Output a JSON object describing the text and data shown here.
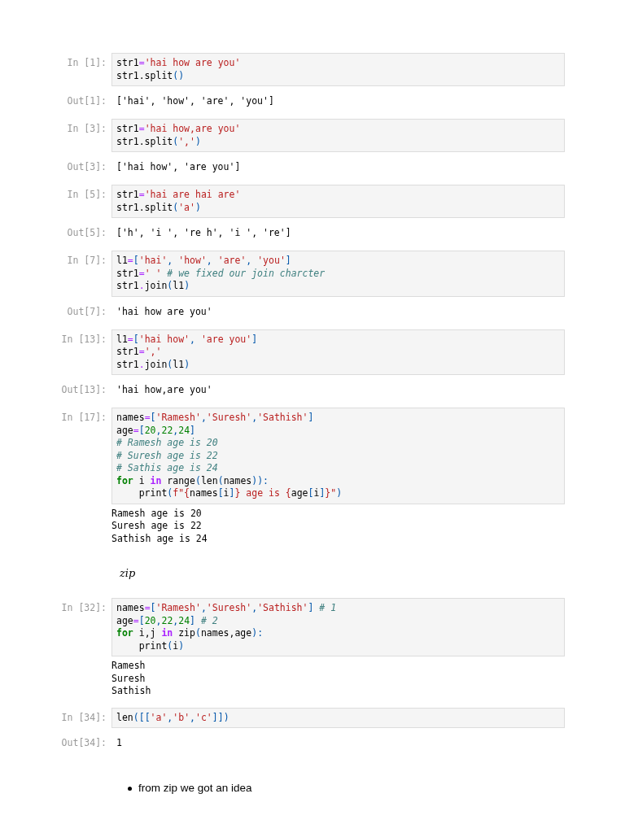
{
  "cells": [
    {
      "kind": "code",
      "prompt": "In [1]:",
      "lines": [
        [
          {
            "kind": "name",
            "text": "str1"
          },
          {
            "kind": "op",
            "text": "="
          },
          {
            "kind": "str",
            "text": "'hai how are you'"
          }
        ],
        [
          {
            "kind": "name",
            "text": "str1.split"
          },
          {
            "kind": "punct",
            "text": "()"
          }
        ]
      ],
      "output": {
        "kind": "result",
        "prompt": "Out[1]:",
        "lines": [
          "['hai', 'how', 'are', 'you']"
        ]
      }
    },
    {
      "kind": "code",
      "prompt": "In [3]:",
      "lines": [
        [
          {
            "kind": "name",
            "text": "str1"
          },
          {
            "kind": "op",
            "text": "="
          },
          {
            "kind": "str",
            "text": "'hai how,are you'"
          }
        ],
        [
          {
            "kind": "name",
            "text": "str1.split"
          },
          {
            "kind": "punct",
            "text": "("
          },
          {
            "kind": "str",
            "text": "','"
          },
          {
            "kind": "punct",
            "text": ")"
          }
        ]
      ],
      "output": {
        "kind": "result",
        "prompt": "Out[3]:",
        "lines": [
          "['hai how', 'are you']"
        ]
      }
    },
    {
      "kind": "code",
      "prompt": "In [5]:",
      "lines": [
        [
          {
            "kind": "name",
            "text": "str1"
          },
          {
            "kind": "op",
            "text": "="
          },
          {
            "kind": "str",
            "text": "'hai are hai are'"
          }
        ],
        [
          {
            "kind": "name",
            "text": "str1.split"
          },
          {
            "kind": "punct",
            "text": "("
          },
          {
            "kind": "str",
            "text": "'a'"
          },
          {
            "kind": "punct",
            "text": ")"
          }
        ]
      ],
      "output": {
        "kind": "result",
        "prompt": "Out[5]:",
        "lines": [
          "['h', 'i ', 're h', 'i ', 're']"
        ]
      }
    },
    {
      "kind": "code",
      "prompt": "In [7]:",
      "lines": [
        [
          {
            "kind": "name",
            "text": "l1"
          },
          {
            "kind": "op",
            "text": "="
          },
          {
            "kind": "punct",
            "text": "["
          },
          {
            "kind": "str",
            "text": "'hai'"
          },
          {
            "kind": "punct",
            "text": ", "
          },
          {
            "kind": "str",
            "text": "'how'"
          },
          {
            "kind": "punct",
            "text": ", "
          },
          {
            "kind": "str",
            "text": "'are'"
          },
          {
            "kind": "punct",
            "text": ", "
          },
          {
            "kind": "str",
            "text": "'you'"
          },
          {
            "kind": "punct",
            "text": "]"
          }
        ],
        [
          {
            "kind": "name",
            "text": "str1"
          },
          {
            "kind": "op",
            "text": "="
          },
          {
            "kind": "str",
            "text": "' ' "
          },
          {
            "kind": "comment",
            "text": "# we fixed our join charcter"
          }
        ],
        [
          {
            "kind": "name",
            "text": "str1"
          },
          {
            "kind": "op",
            "text": "."
          },
          {
            "kind": "name",
            "text": "join"
          },
          {
            "kind": "punct",
            "text": "("
          },
          {
            "kind": "name",
            "text": "l1"
          },
          {
            "kind": "punct",
            "text": ")"
          }
        ]
      ],
      "output": {
        "kind": "result",
        "prompt": "Out[7]:",
        "lines": [
          "'hai how are you'"
        ]
      }
    },
    {
      "kind": "code",
      "prompt": "In [13]:",
      "lines": [
        [
          {
            "kind": "name",
            "text": "l1"
          },
          {
            "kind": "op",
            "text": "="
          },
          {
            "kind": "punct",
            "text": "["
          },
          {
            "kind": "str",
            "text": "'hai how'"
          },
          {
            "kind": "punct",
            "text": ", "
          },
          {
            "kind": "str",
            "text": "'are you'"
          },
          {
            "kind": "punct",
            "text": "]"
          }
        ],
        [
          {
            "kind": "name",
            "text": "str1"
          },
          {
            "kind": "op",
            "text": "="
          },
          {
            "kind": "str",
            "text": "','"
          }
        ],
        [
          {
            "kind": "name",
            "text": "str1"
          },
          {
            "kind": "op",
            "text": "."
          },
          {
            "kind": "name",
            "text": "join"
          },
          {
            "kind": "punct",
            "text": "("
          },
          {
            "kind": "name",
            "text": "l1"
          },
          {
            "kind": "punct",
            "text": ")"
          }
        ]
      ],
      "output": {
        "kind": "result",
        "prompt": "Out[13]:",
        "lines": [
          "'hai how,are you'"
        ]
      }
    },
    {
      "kind": "code",
      "prompt": "In [17]:",
      "lines": [
        [
          {
            "kind": "name",
            "text": "names"
          },
          {
            "kind": "op",
            "text": "="
          },
          {
            "kind": "punct",
            "text": "["
          },
          {
            "kind": "str",
            "text": "'Ramesh'"
          },
          {
            "kind": "punct",
            "text": ","
          },
          {
            "kind": "str",
            "text": "'Suresh'"
          },
          {
            "kind": "punct",
            "text": ","
          },
          {
            "kind": "str",
            "text": "'Sathish'"
          },
          {
            "kind": "punct",
            "text": "]"
          }
        ],
        [
          {
            "kind": "name",
            "text": "age"
          },
          {
            "kind": "op",
            "text": "="
          },
          {
            "kind": "punct",
            "text": "["
          },
          {
            "kind": "num",
            "text": "20"
          },
          {
            "kind": "punct",
            "text": ","
          },
          {
            "kind": "num",
            "text": "22"
          },
          {
            "kind": "punct",
            "text": ","
          },
          {
            "kind": "num",
            "text": "24"
          },
          {
            "kind": "punct",
            "text": "]"
          }
        ],
        [
          {
            "kind": "comment",
            "text": "# Ramesh age is 20"
          }
        ],
        [
          {
            "kind": "comment",
            "text": "# Suresh age is 22"
          }
        ],
        [
          {
            "kind": "comment",
            "text": "# Sathis age is 24"
          }
        ],
        [
          {
            "kind": "keyword",
            "text": "for"
          },
          {
            "kind": "name",
            "text": " i "
          },
          {
            "kind": "opword",
            "text": "in"
          },
          {
            "kind": "name",
            "text": " range"
          },
          {
            "kind": "punct",
            "text": "("
          },
          {
            "kind": "name",
            "text": "len"
          },
          {
            "kind": "punct",
            "text": "("
          },
          {
            "kind": "name",
            "text": "names"
          },
          {
            "kind": "punct",
            "text": ")):"
          }
        ],
        [
          {
            "kind": "name",
            "text": "    print"
          },
          {
            "kind": "punct",
            "text": "("
          },
          {
            "kind": "str",
            "text": "f\"{"
          },
          {
            "kind": "name",
            "text": "names"
          },
          {
            "kind": "punct",
            "text": "["
          },
          {
            "kind": "name",
            "text": "i"
          },
          {
            "kind": "punct",
            "text": "]"
          },
          {
            "kind": "str",
            "text": "} age is {"
          },
          {
            "kind": "name",
            "text": "age"
          },
          {
            "kind": "punct",
            "text": "["
          },
          {
            "kind": "name",
            "text": "i"
          },
          {
            "kind": "punct",
            "text": "]"
          },
          {
            "kind": "str",
            "text": "}\""
          },
          {
            "kind": "punct",
            "text": ")"
          }
        ]
      ],
      "output": {
        "kind": "stream",
        "lines": [
          "Ramesh age is 20",
          "Suresh age is 22",
          "Sathish age is 24"
        ]
      }
    },
    {
      "kind": "math",
      "text": "zip"
    },
    {
      "kind": "code",
      "prompt": "In [32]:",
      "lines": [
        [
          {
            "kind": "name",
            "text": "names"
          },
          {
            "kind": "op",
            "text": "="
          },
          {
            "kind": "punct",
            "text": "["
          },
          {
            "kind": "str",
            "text": "'Ramesh'"
          },
          {
            "kind": "punct",
            "text": ","
          },
          {
            "kind": "str",
            "text": "'Suresh'"
          },
          {
            "kind": "punct",
            "text": ","
          },
          {
            "kind": "str",
            "text": "'Sathish'"
          },
          {
            "kind": "punct",
            "text": "] "
          },
          {
            "kind": "comment",
            "text": "# 1"
          }
        ],
        [
          {
            "kind": "name",
            "text": "age"
          },
          {
            "kind": "op",
            "text": "="
          },
          {
            "kind": "punct",
            "text": "["
          },
          {
            "kind": "num",
            "text": "20"
          },
          {
            "kind": "punct",
            "text": ","
          },
          {
            "kind": "num",
            "text": "22"
          },
          {
            "kind": "punct",
            "text": ","
          },
          {
            "kind": "num",
            "text": "24"
          },
          {
            "kind": "punct",
            "text": "] "
          },
          {
            "kind": "comment",
            "text": "# 2"
          }
        ],
        [
          {
            "kind": "keyword",
            "text": "for"
          },
          {
            "kind": "name",
            "text": " i,j "
          },
          {
            "kind": "opword",
            "text": "in"
          },
          {
            "kind": "name",
            "text": " zip"
          },
          {
            "kind": "punct",
            "text": "("
          },
          {
            "kind": "name",
            "text": "names,age"
          },
          {
            "kind": "punct",
            "text": "):"
          }
        ],
        [
          {
            "kind": "name",
            "text": "    print"
          },
          {
            "kind": "punct",
            "text": "("
          },
          {
            "kind": "name",
            "text": "i"
          },
          {
            "kind": "punct",
            "text": ")"
          }
        ]
      ],
      "output": {
        "kind": "stream",
        "lines": [
          "Ramesh",
          "Suresh",
          "Sathish"
        ]
      }
    },
    {
      "kind": "code",
      "prompt": "In [34]:",
      "lines": [
        [
          {
            "kind": "name",
            "text": "len"
          },
          {
            "kind": "punct",
            "text": "([["
          },
          {
            "kind": "str",
            "text": "'a'"
          },
          {
            "kind": "punct",
            "text": ","
          },
          {
            "kind": "str",
            "text": "'b'"
          },
          {
            "kind": "punct",
            "text": ","
          },
          {
            "kind": "str",
            "text": "'c'"
          },
          {
            "kind": "punct",
            "text": "]])"
          }
        ]
      ],
      "output": {
        "kind": "result",
        "prompt": "Out[34]:",
        "lines": [
          "1"
        ]
      }
    },
    {
      "kind": "bullets",
      "items": [
        "from zip we got an idea"
      ]
    }
  ]
}
